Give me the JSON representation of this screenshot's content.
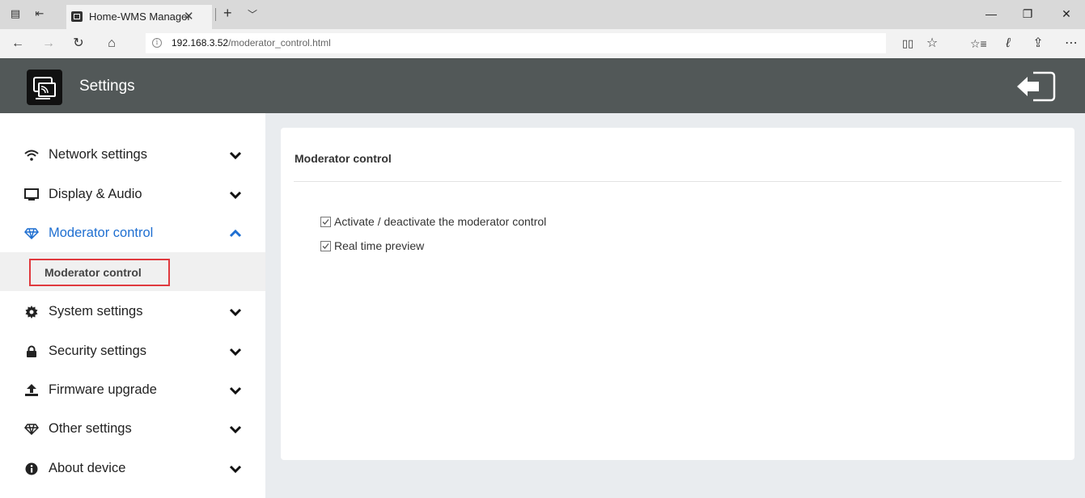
{
  "browser": {
    "tab_title": "Home-WMS Manager",
    "tab_close": "✕",
    "new_tab": "+",
    "url_host": "192.168.3.52",
    "url_path": "/moderator_control.html"
  },
  "app": {
    "title": "Settings"
  },
  "sidebar": {
    "items": [
      {
        "label": "Network settings",
        "icon": "wifi-icon"
      },
      {
        "label": "Display & Audio",
        "icon": "monitor-icon"
      },
      {
        "label": "Moderator control",
        "icon": "diamond-icon",
        "active": true
      },
      {
        "label": "System settings",
        "icon": "gear-icon"
      },
      {
        "label": "Security settings",
        "icon": "lock-icon"
      },
      {
        "label": "Firmware upgrade",
        "icon": "upload-icon"
      },
      {
        "label": "Other settings",
        "icon": "diamond-icon"
      },
      {
        "label": "About device",
        "icon": "info-icon"
      }
    ],
    "submenu": {
      "label": "Moderator control"
    }
  },
  "main": {
    "title": "Moderator control",
    "options": [
      {
        "label": "Activate / deactivate the moderator control",
        "checked": true
      },
      {
        "label": "Real time preview",
        "checked": true
      }
    ]
  },
  "colors": {
    "header_bg": "#525858",
    "active_text": "#1f6fd1",
    "highlight_border": "#e0393e"
  }
}
